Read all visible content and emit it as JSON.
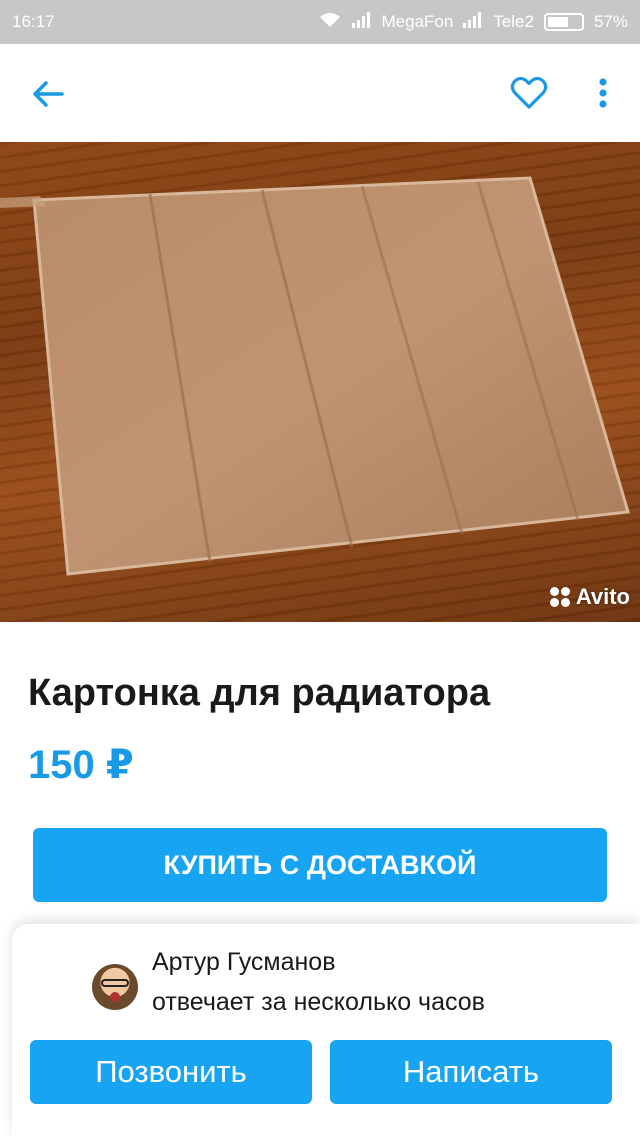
{
  "status_bar": {
    "time": "16:17",
    "carrier1": "MegaFon",
    "carrier2": "Tele2",
    "battery": "57%"
  },
  "app_bar": {
    "back_icon": "arrow-left-icon",
    "favorite_icon": "heart-outline-icon",
    "more_icon": "more-vertical-icon"
  },
  "photo": {
    "watermark": "Avito"
  },
  "listing": {
    "title": "Картонка для радиатора",
    "price": "150 ₽"
  },
  "buy_button": {
    "label": "Купить с доставкой"
  },
  "seller": {
    "name": "Артур Гусманов",
    "response_time": "отвечает за несколько часов"
  },
  "actions": {
    "call_label": "Позвонить",
    "write_label": "Написать"
  },
  "colors": {
    "accent": "#16a4f3",
    "price": "#199ae6"
  }
}
